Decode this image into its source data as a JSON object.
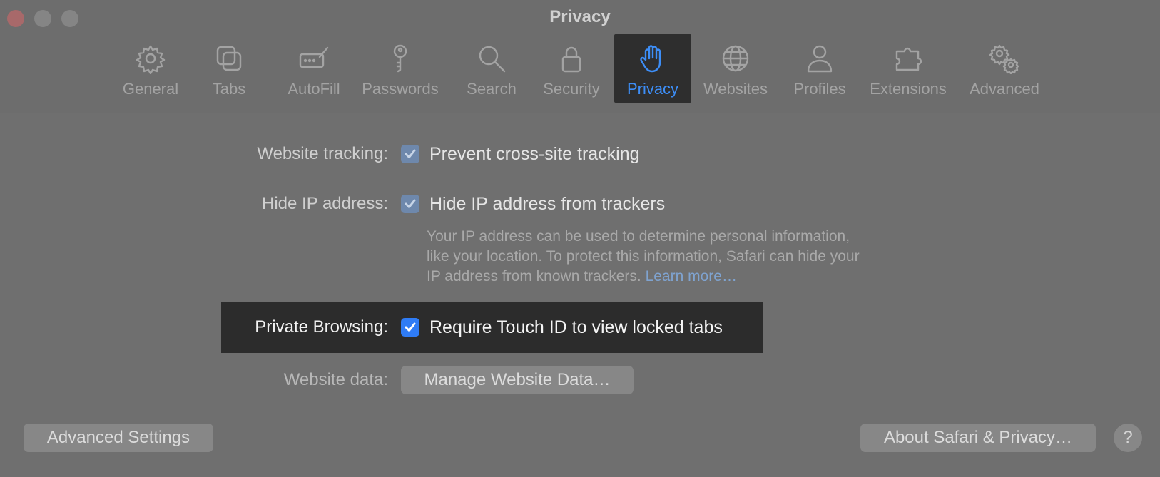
{
  "window": {
    "title": "Privacy"
  },
  "toolbar": {
    "tabs": [
      {
        "id": "general",
        "label": "General",
        "icon": "gear-icon"
      },
      {
        "id": "tabs",
        "label": "Tabs",
        "icon": "tabs-icon"
      },
      {
        "id": "autofill",
        "label": "AutoFill",
        "icon": "autofill-icon"
      },
      {
        "id": "passwords",
        "label": "Passwords",
        "icon": "key-icon"
      },
      {
        "id": "search",
        "label": "Search",
        "icon": "search-icon"
      },
      {
        "id": "security",
        "label": "Security",
        "icon": "lock-icon"
      },
      {
        "id": "privacy",
        "label": "Privacy",
        "icon": "hand-icon",
        "active": true
      },
      {
        "id": "websites",
        "label": "Websites",
        "icon": "globe-icon"
      },
      {
        "id": "profiles",
        "label": "Profiles",
        "icon": "person-icon"
      },
      {
        "id": "extensions",
        "label": "Extensions",
        "icon": "puzzle-icon"
      },
      {
        "id": "advanced",
        "label": "Advanced",
        "icon": "gears-icon"
      }
    ]
  },
  "settings": {
    "website_tracking": {
      "label": "Website tracking:",
      "option": "Prevent cross-site tracking",
      "checked": true
    },
    "hide_ip": {
      "label": "Hide IP address:",
      "option": "Hide IP address from trackers",
      "checked": true,
      "help_line1": "Your IP address can be used to determine personal information,",
      "help_line2": "like your location. To protect this information, Safari can hide your",
      "help_line3": "IP address from known trackers.",
      "learn_more": "Learn more…"
    },
    "private_browsing": {
      "label": "Private Browsing:",
      "option": "Require Touch ID to view locked tabs",
      "checked": true
    },
    "website_data": {
      "label": "Website data:",
      "button": "Manage Website Data…"
    }
  },
  "footer": {
    "advanced_settings": "Advanced Settings",
    "about": "About Safari & Privacy…",
    "help": "?"
  },
  "colors": {
    "accent": "#3d8ef7",
    "highlight": "#2c2c2c",
    "background": "#6f6f6f"
  }
}
